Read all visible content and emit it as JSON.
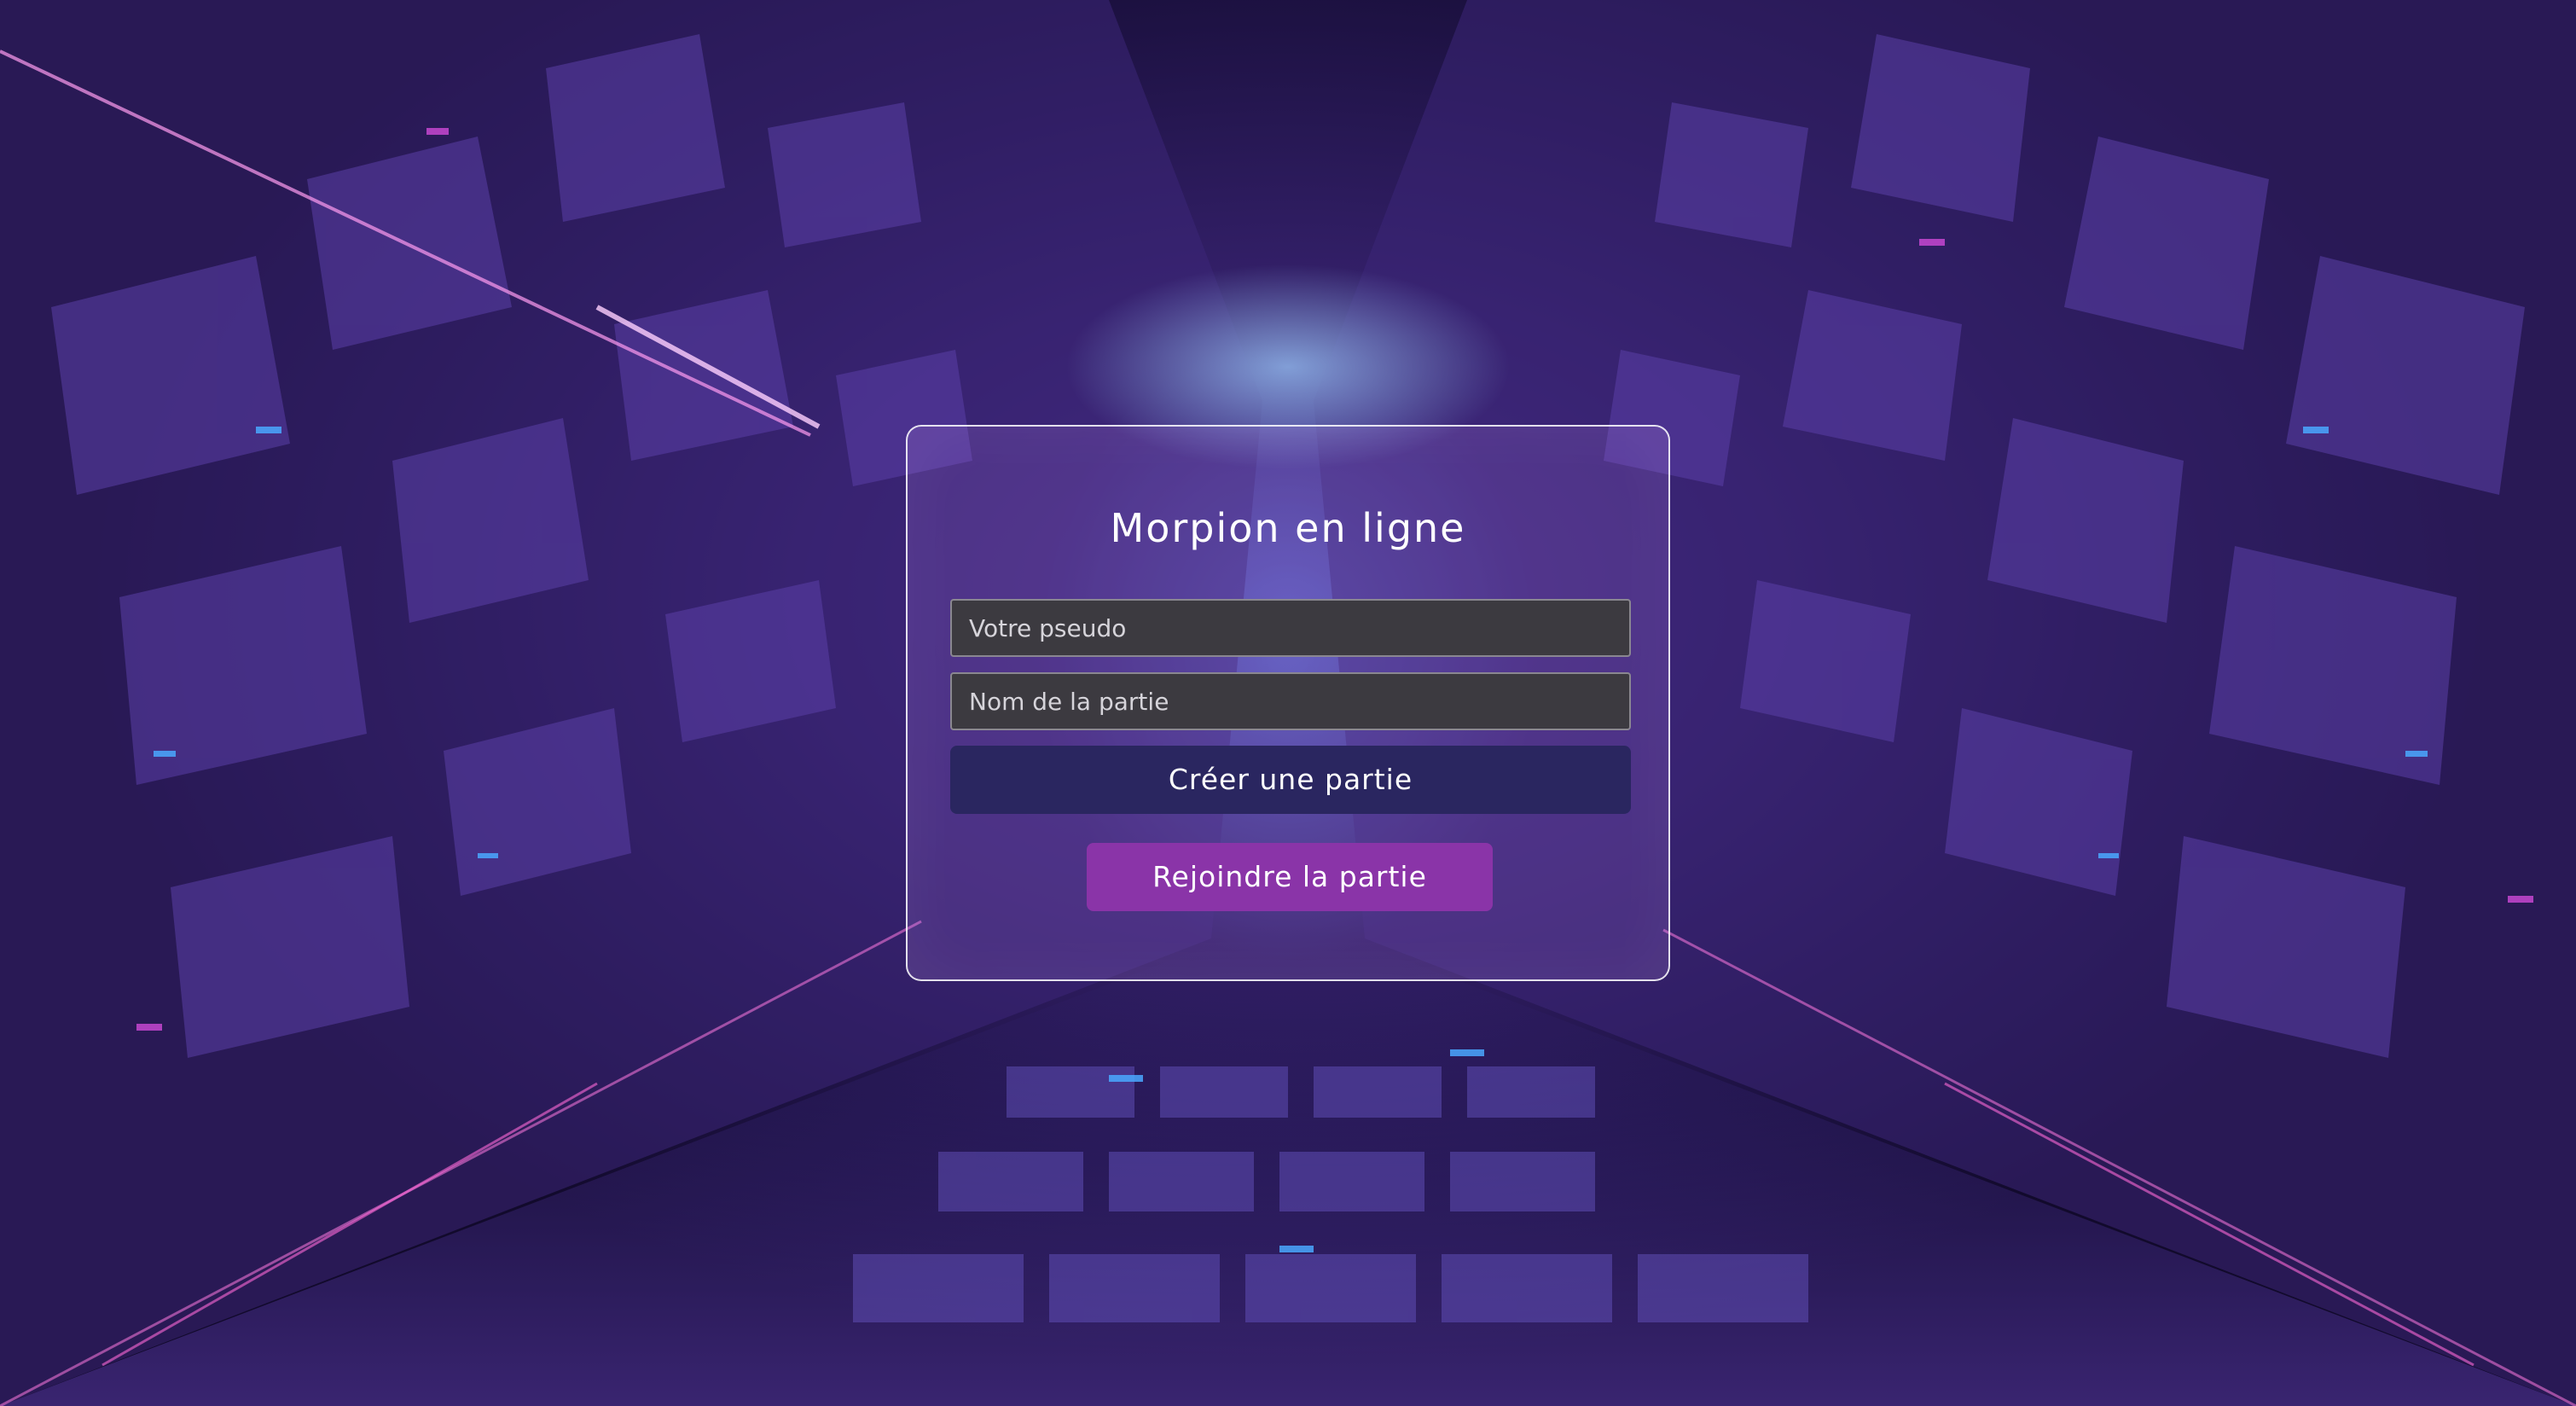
{
  "app": {
    "title": "Morpion en ligne"
  },
  "form": {
    "pseudo_placeholder": "Votre pseudo",
    "pseudo_value": "",
    "game_name_placeholder": "Nom de la partie",
    "game_name_value": "",
    "create_label": "Créer une partie",
    "join_label": "Rejoindre la partie"
  },
  "colors": {
    "background_primary": "#34206a",
    "background_dark": "#120a2c",
    "accent_blue": "#4aa8ff",
    "accent_magenta": "#d04ad8",
    "create_button": "#2a2660",
    "join_button": "#8a34a8",
    "input_background": "#3c3a40",
    "text": "#ffffff"
  }
}
